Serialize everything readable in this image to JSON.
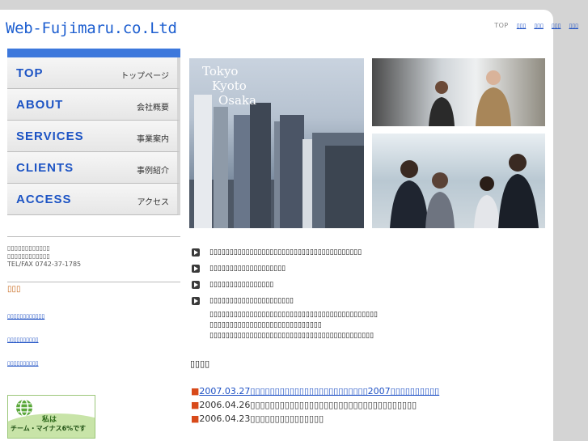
{
  "site": {
    "logo": "Web-Fujimaru.co.Ltd"
  },
  "topnav": {
    "top": "TOP",
    "links": [
      "▯▯▯",
      "▯▯▯",
      "▯▯▯",
      "▯▯▯"
    ]
  },
  "menu": [
    {
      "en": "TOP",
      "jp": "トップページ"
    },
    {
      "en": "ABOUT",
      "jp": "会社概要"
    },
    {
      "en": "SERVICES",
      "jp": "事業案内"
    },
    {
      "en": "CLIENTS",
      "jp": "事例紹介"
    },
    {
      "en": "ACCESS",
      "jp": "アクセス"
    }
  ],
  "address": {
    "line1": "▯▯▯▯▯▯▯▯▯▯▯▯",
    "line2": "▯▯▯▯▯▯▯▯▯▯▯▯",
    "tel": "TEL/FAX 0742-37-1785"
  },
  "side_section": {
    "title": "▯▯▯",
    "links": [
      "▯▯▯▯▯▯▯▯▯▯▯▯",
      "▯▯▯▯▯▯▯▯▯▯",
      "▯▯▯▯▯▯▯▯▯▯"
    ]
  },
  "badge": {
    "line1": "私は",
    "line2": "チーム・マイナス6%です"
  },
  "hero": {
    "caption": [
      "Tokyo",
      "Kyoto",
      "Osaka"
    ]
  },
  "bullets": [
    "▯▯▯▯▯▯▯▯▯▯▯▯▯▯▯▯▯▯▯▯▯▯▯▯▯▯▯▯▯▯▯▯▯▯▯▯▯▯",
    "▯▯▯▯▯▯▯▯▯▯▯▯▯▯▯▯▯▯▯",
    "▯▯▯▯▯▯▯▯▯▯▯▯▯▯▯▯",
    "▯▯▯▯▯▯▯▯▯▯▯▯▯▯▯▯▯▯▯▯▯"
  ],
  "paragraph": [
    "▯▯▯▯▯▯▯▯▯▯▯▯▯▯▯▯▯▯▯▯▯▯▯▯▯▯▯▯▯▯▯▯▯▯▯▯▯▯▯▯▯▯",
    "▯▯▯▯▯▯▯▯▯▯▯▯▯▯▯▯▯▯▯▯▯▯▯▯▯▯▯▯",
    "▯▯▯▯▯▯▯▯▯▯▯▯▯▯▯▯▯▯▯▯▯▯▯▯▯▯▯▯▯▯▯▯▯▯▯▯▯▯▯▯▯"
  ],
  "news": {
    "title": "▯▯▯▯",
    "items": [
      {
        "date": "2007.03.27",
        "text": "▯▯▯▯▯▯▯▯▯▯▯▯▯▯▯▯▯▯▯▯▯▯▯▯2007▯▯▯▯▯▯▯▯▯▯"
      },
      {
        "date": "2006.04.26",
        "text": "▯▯▯▯▯▯▯▯▯▯▯▯▯▯▯▯▯▯▯▯▯▯▯▯▯▯▯▯▯▯▯▯▯▯"
      },
      {
        "date": "2006.04.23",
        "text": "▯▯▯▯▯▯▯▯▯▯▯▯▯▯▯"
      }
    ]
  },
  "colors": {
    "brand_blue": "#1e5fd0",
    "menu_bar": "#3d78dc",
    "news_marker": "#d84a1a",
    "section_title": "#c86a1e"
  }
}
